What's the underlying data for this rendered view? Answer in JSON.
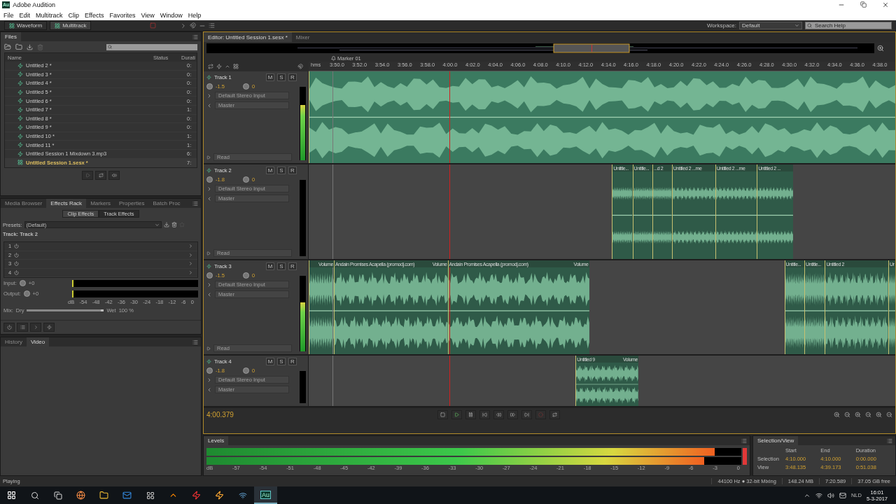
{
  "window": {
    "logo": "Au",
    "title": "Adobe Audition"
  },
  "menu": [
    "File",
    "Edit",
    "Multitrack",
    "Clip",
    "Effects",
    "Favorites",
    "View",
    "Window",
    "Help"
  ],
  "toolbar": {
    "views": [
      {
        "label": "Waveform",
        "selected": false
      },
      {
        "label": "Multitrack",
        "selected": true
      }
    ],
    "workspace_label": "Workspace:",
    "workspace": "Default",
    "search": {
      "placeholder": "Search Help"
    }
  },
  "files_panel": {
    "tab": "Files",
    "columns": [
      "Name",
      "Status",
      "Durati"
    ],
    "items": [
      {
        "name": "Untitled 2 *",
        "duration": "0:",
        "kind": "audio",
        "selected": false
      },
      {
        "name": "Untitled 3 *",
        "duration": "0:",
        "kind": "audio",
        "selected": false
      },
      {
        "name": "Untitled 4 *",
        "duration": "0:",
        "kind": "audio",
        "selected": false
      },
      {
        "name": "Untitled 5 *",
        "duration": "0:",
        "kind": "audio",
        "selected": false
      },
      {
        "name": "Untitled 6 *",
        "duration": "0:",
        "kind": "audio",
        "selected": false
      },
      {
        "name": "Untitled 7 *",
        "duration": "1:",
        "kind": "audio",
        "selected": false
      },
      {
        "name": "Untitled 8 *",
        "duration": "0:",
        "kind": "audio",
        "selected": false
      },
      {
        "name": "Untitled 9 *",
        "duration": "0:",
        "kind": "audio",
        "selected": false
      },
      {
        "name": "Untitled 10 *",
        "duration": "1:",
        "kind": "audio",
        "selected": false
      },
      {
        "name": "Untitled 11 *",
        "duration": "1:",
        "kind": "audio",
        "selected": false
      },
      {
        "name": "Untitled Session 1 Mixdown 3.mp3",
        "duration": "6:",
        "kind": "audio",
        "selected": false
      },
      {
        "name": "Untitled Session 1.sesx *",
        "duration": "7:",
        "kind": "session",
        "selected": true
      }
    ]
  },
  "effects_panel": {
    "tabs": [
      {
        "label": "Media Browser",
        "selected": false
      },
      {
        "label": "Effects Rack",
        "selected": true
      },
      {
        "label": "Markers",
        "selected": false
      },
      {
        "label": "Properties",
        "selected": false
      },
      {
        "label": "Batch Proc",
        "selected": false
      }
    ],
    "modes": [
      {
        "label": "Clip Effects",
        "selected": false
      },
      {
        "label": "Track Effects",
        "selected": true
      }
    ],
    "presets_label": "Presets:",
    "preset": "(Default)",
    "track_label": "Track: Track 2",
    "slots": [
      "1",
      "2",
      "3",
      "4"
    ],
    "input_label": "Input:",
    "input_value": "+0",
    "output_label": "Output:",
    "output_value": "+0",
    "scale": [
      "dB",
      "-54",
      "-48",
      "-42",
      "-36",
      "-30",
      "-24",
      "-18",
      "-12",
      "-6",
      "0"
    ],
    "mix_label": "Mix:",
    "dry": "Dry",
    "wet": "Wet",
    "mix": {
      "level": 1
    },
    "mix_value": "100 %"
  },
  "bottom_left_tabs": [
    {
      "label": "History",
      "selected": false
    },
    {
      "label": "Video",
      "selected": true
    }
  ],
  "editor": {
    "tabs": [
      {
        "label": "Editor: Untitled Session 1.sesx *",
        "selected": true
      },
      {
        "label": "Mixer",
        "selected": false
      }
    ],
    "marker": "Marker 01",
    "ruler_unit": "hms",
    "ruler": [
      "3:50.0",
      "3:52.0",
      "3:54.0",
      "3:56.0",
      "3:58.0",
      "4:00.0",
      "4:02.0",
      "4:04.0",
      "4:06.0",
      "4:08.0",
      "4:10.0",
      "4:12.0",
      "4:14.0",
      "4:16.0",
      "4:18.0",
      "4:20.0",
      "4:22.0",
      "4:24.0",
      "4:26.0",
      "4:28.0",
      "4:30.0",
      "4:32.0",
      "4:34.0",
      "4:36.0",
      "4:38.0"
    ],
    "tracks": [
      {
        "name": "Track 1",
        "buttons": [
          "M",
          "S",
          "R"
        ],
        "volume": "-1.5",
        "pan": "0",
        "input": "Default Stereo Input",
        "output": "Master",
        "automation": "Read",
        "meter": {
          "level": 0.75
        },
        "clips": [
          {
            "selected": true
          }
        ]
      },
      {
        "name": "Track 2",
        "buttons": [
          "M",
          "S",
          "R"
        ],
        "volume": "-1.8",
        "pan": "0",
        "input": "Default Stereo Input",
        "output": "Master",
        "automation": "Read",
        "meter": {
          "level": 0
        },
        "clips": [
          {
            "title": "Untitle...",
            "selected": false
          },
          {
            "title": "Untitle...",
            "selected": false
          },
          {
            "title": "...d 2",
            "selected": false
          },
          {
            "title": "Untitled 2 ...me",
            "selected": false
          },
          {
            "title": "Untitled 2 ...me",
            "selected": false
          },
          {
            "title": "Untitled 2 ...",
            "selected": false
          }
        ]
      },
      {
        "name": "Track 3",
        "buttons": [
          "M",
          "S",
          "R"
        ],
        "volume": "-1.5",
        "pan": "0",
        "input": "Default Stereo Input",
        "output": "Master",
        "automation": "Read",
        "meter": {
          "level": 0.65
        },
        "clips": [
          {
            "label": "Volume",
            "selected": false
          },
          {
            "title": "Andain Promises Acapella (promodj.com)",
            "label": "Volume",
            "selected": false
          },
          {
            "title": "Andain Promises Acapella (promodj.com)",
            "label": "Volume",
            "selected": false
          },
          {
            "title": "Untitle...",
            "selected": false
          },
          {
            "title": "Untitle...",
            "selected": false
          },
          {
            "title": "Untitled 2",
            "selected": false
          },
          {
            "title": "Ur",
            "selected": false
          }
        ]
      },
      {
        "name": "Track 4",
        "buttons": [
          "M",
          "S",
          "R"
        ],
        "volume": "-1.8",
        "pan": "0",
        "input": "Default Stereo Input",
        "output": "Master",
        "meter": {
          "level": 0
        },
        "clips": [
          {
            "title": "Untitled 9",
            "label": "Volume",
            "selected": false
          }
        ]
      }
    ],
    "time": "4:00.379",
    "playing": true
  },
  "levels": {
    "title": "Levels",
    "channels": [
      {
        "level": 0.95
      },
      {
        "level": 0.93
      }
    ],
    "clipping": true,
    "scale": [
      "dB",
      "-57",
      "-54",
      "-51",
      "-48",
      "-45",
      "-42",
      "-39",
      "-36",
      "-33",
      "-30",
      "-27",
      "-24",
      "-21",
      "-18",
      "-15",
      "-12",
      "-9",
      "-6",
      "-3",
      "0"
    ]
  },
  "selection_view": {
    "title": "Selection/View",
    "columns": [
      "Start",
      "End",
      "Duration"
    ],
    "rows": [
      {
        "label": "Selection",
        "values": [
          "4:10.000",
          "4:10.000",
          "0:00.000"
        ]
      },
      {
        "label": "View",
        "values": [
          "3:48.135",
          "4:39.173",
          "0:51.038"
        ]
      }
    ]
  },
  "status_bar": {
    "state": "Playing",
    "items": [
      "44100 Hz ● 32-bit Mixing",
      "148.24 MB",
      "7:20.589",
      "37.05 GB free"
    ]
  },
  "taskbar": {
    "active_app": "Au",
    "language": "NLD",
    "time": "16:01",
    "date": "5-3-2017"
  }
}
